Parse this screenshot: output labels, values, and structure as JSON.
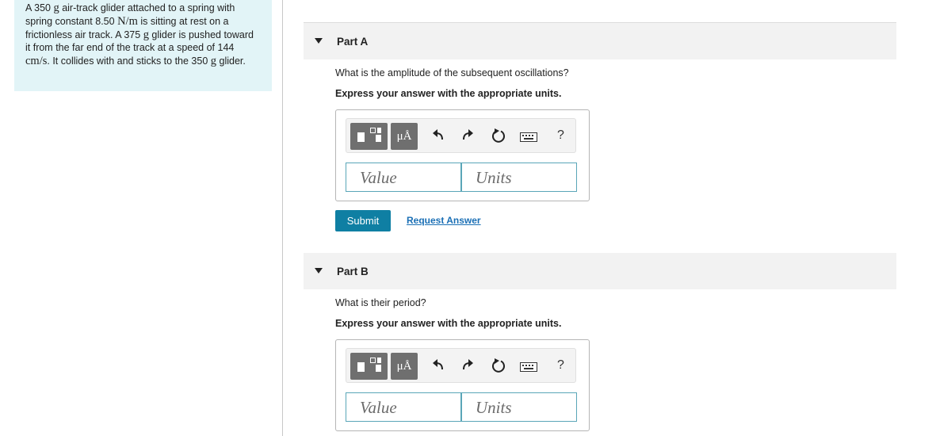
{
  "problem": {
    "p1": "A 350",
    "m1": "g",
    "p2": "air-track glider attached to a spring with spring constant 8.50",
    "m2": "N/m",
    "p3": "is sitting at rest on a frictionless air track. A 375",
    "m3": "g",
    "p4": "glider is pushed toward it from the far end of the track at a speed of 144",
    "m4": "cm/s",
    "p5": ". It collides with and sticks to the 350",
    "m5": "g",
    "p6": "glider."
  },
  "parts": [
    {
      "title": "Part A",
      "question": "What is the amplitude of the subsequent oscillations?",
      "instruction": "Express your answer with the appropriate units.",
      "mu_label": "μÅ",
      "help_label": "?",
      "value_placeholder": "Value",
      "units_placeholder": "Units",
      "submit_label": "Submit",
      "request_label": "Request Answer"
    },
    {
      "title": "Part B",
      "question": "What is their period?",
      "instruction": "Express your answer with the appropriate units.",
      "mu_label": "μÅ",
      "help_label": "?",
      "value_placeholder": "Value",
      "units_placeholder": "Units"
    }
  ],
  "colors": {
    "problem_bg": "#e2f4f7",
    "header_bg": "#f2f2f2",
    "submit_bg": "#0f7fa3",
    "link": "#1a6fb5",
    "field_border": "#5aa6b8"
  },
  "icons": [
    "template-icon",
    "undo-icon",
    "redo-icon",
    "reset-icon",
    "keyboard-icon",
    "help-icon",
    "collapse-triangle-icon"
  ]
}
